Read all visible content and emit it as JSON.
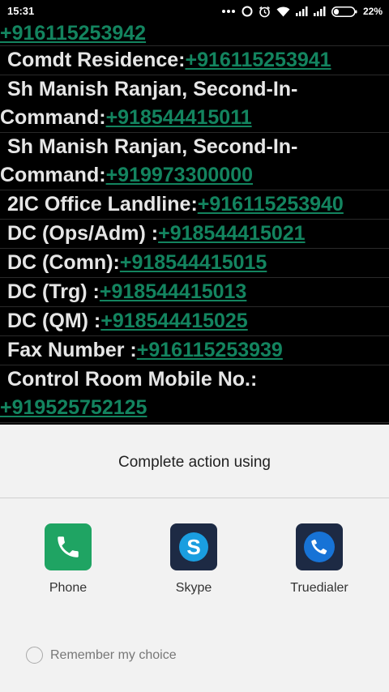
{
  "status_bar": {
    "time": "15:31",
    "battery_percent": "22%",
    "icons": [
      "more-dots-icon",
      "sync-circle-icon",
      "alarm-clock-icon",
      "wifi-icon",
      "signal-icon",
      "signal-icon",
      "battery-icon"
    ]
  },
  "contacts": {
    "first_phone": "+916115253942",
    "entries": [
      {
        "label": "Comdt Residence",
        "separator": ":",
        "phone": "+916115253941"
      },
      {
        "label_line1": "Sh Manish Ranjan, Second-In-",
        "label_line2": "Command",
        "separator": ":",
        "phone": "+918544415011"
      },
      {
        "label_line1": "Sh Manish Ranjan, Second-In-",
        "label_line2": "Command",
        "separator": ":",
        "phone": "+919973300000"
      },
      {
        "label": "2IC Office Landline",
        "separator": ":",
        "phone": "+916115253940"
      },
      {
        "label": "DC (Ops/Adm)",
        "separator": " :",
        "phone": "+918544415021"
      },
      {
        "label": "DC (Comn)",
        "separator": ":",
        "phone": "+918544415015"
      },
      {
        "label": "DC (Trg)",
        "separator": " :",
        "phone": "+918544415013"
      },
      {
        "label": "DC (QM)",
        "separator": " :",
        "phone": "+918544415025"
      },
      {
        "label": "Fax Number",
        "separator": " :",
        "phone": "+916115253939"
      },
      {
        "label_line1": "Control Room Mobile No.:",
        "phone_line2": "+919525752125"
      }
    ]
  },
  "chooser": {
    "title": "Complete action using",
    "apps": [
      {
        "label": "Phone",
        "icon": "phone-handset-icon",
        "color": "#1fa463"
      },
      {
        "label": "Skype",
        "icon": "skype-icon",
        "color": "#1a9ee0"
      },
      {
        "label": "Truedialer",
        "icon": "truedialer-icon",
        "color": "#1773d6"
      }
    ],
    "remember_label": "Remember my choice"
  }
}
